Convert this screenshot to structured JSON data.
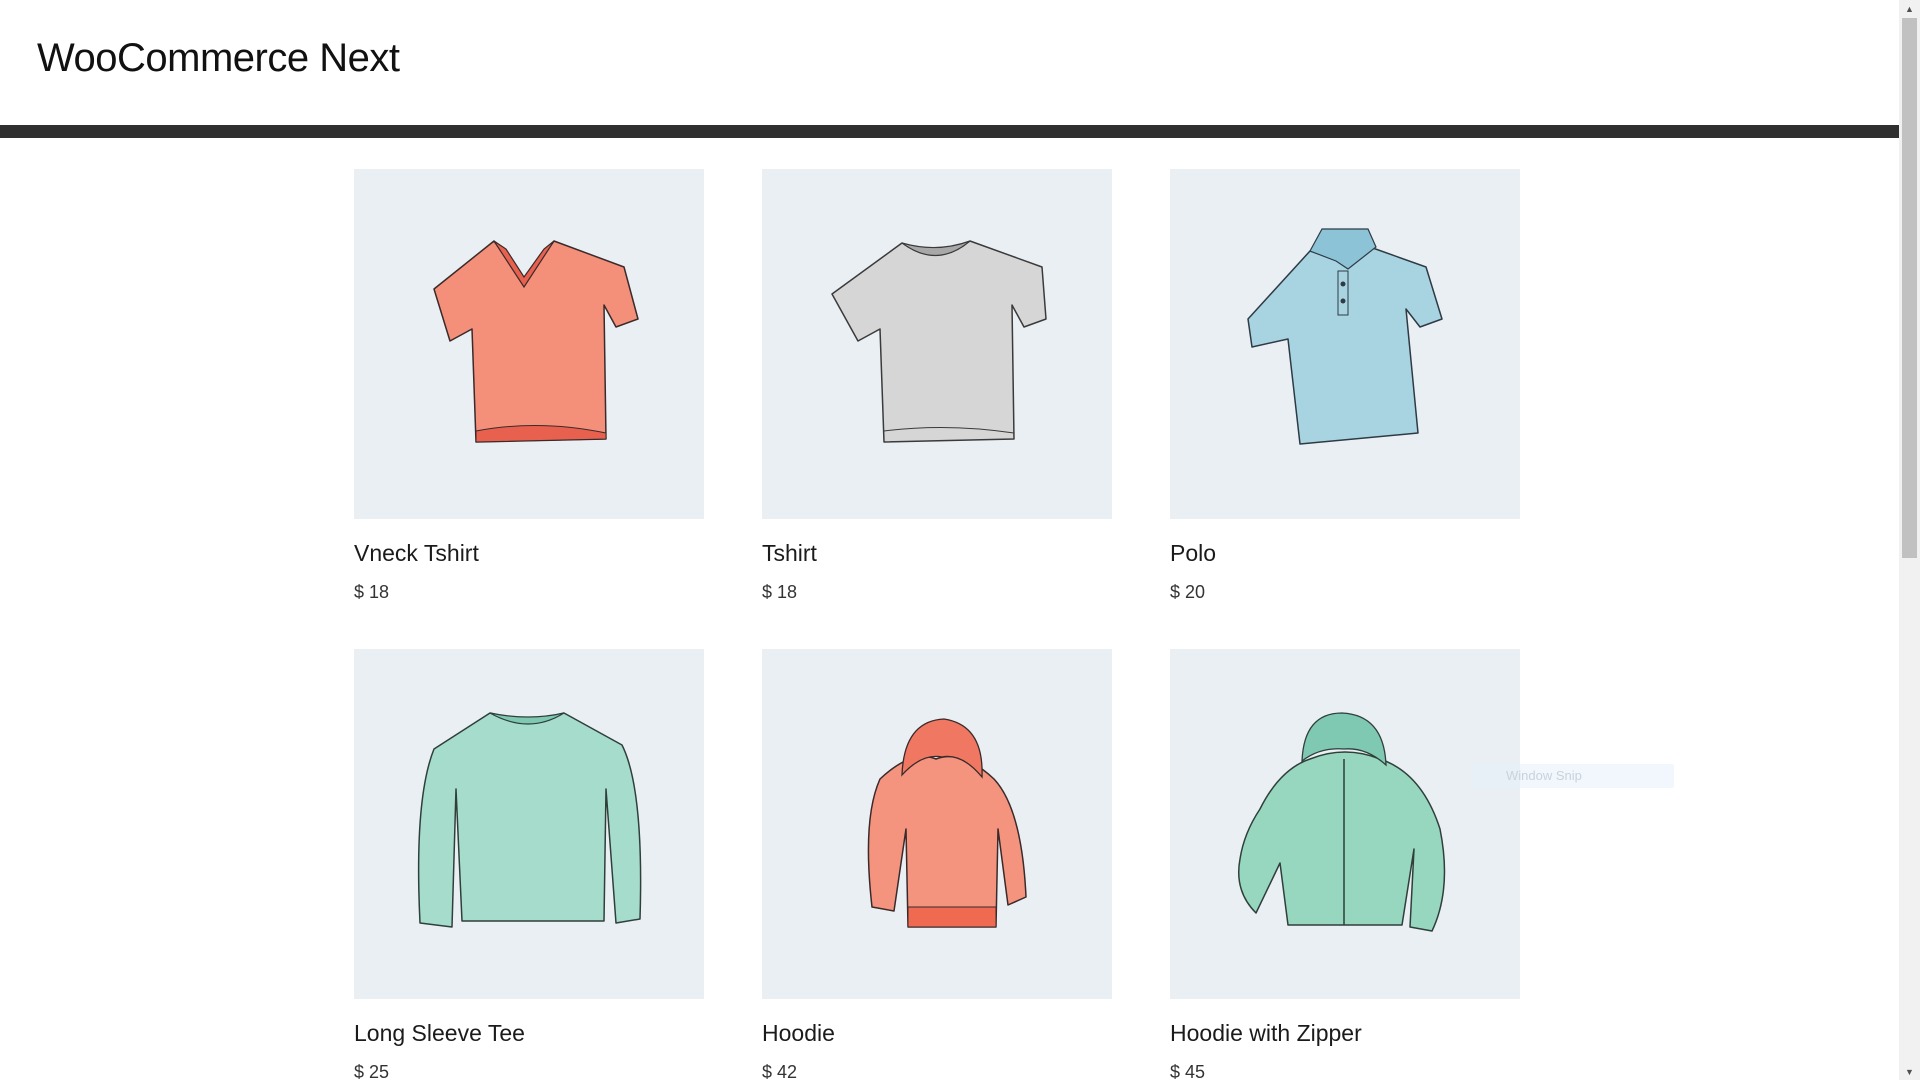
{
  "site": {
    "title": "WooCommerce Next"
  },
  "products": [
    {
      "name": "Vneck Tshirt",
      "price": "$ 18",
      "icon": "vneck-tshirt-image",
      "color": "#f4907a"
    },
    {
      "name": "Tshirt",
      "price": "$ 18",
      "icon": "tshirt-image",
      "color": "#d6d6d6"
    },
    {
      "name": "Polo",
      "price": "$ 20",
      "icon": "polo-image",
      "color": "#a8d4e2"
    },
    {
      "name": "Long Sleeve Tee",
      "price": "$ 25",
      "icon": "long-sleeve-tee-image",
      "color": "#a6dccb"
    },
    {
      "name": "Hoodie",
      "price": "$ 42",
      "icon": "hoodie-image",
      "color": "#f4947f"
    },
    {
      "name": "Hoodie with Zipper",
      "price": "$ 45",
      "icon": "hoodie-zipper-image",
      "color": "#97d6bf"
    }
  ],
  "overlay": {
    "label": "Window Snip"
  },
  "colors": {
    "header_bar": "#2f2f2f",
    "image_bg": "#eaeff4"
  }
}
